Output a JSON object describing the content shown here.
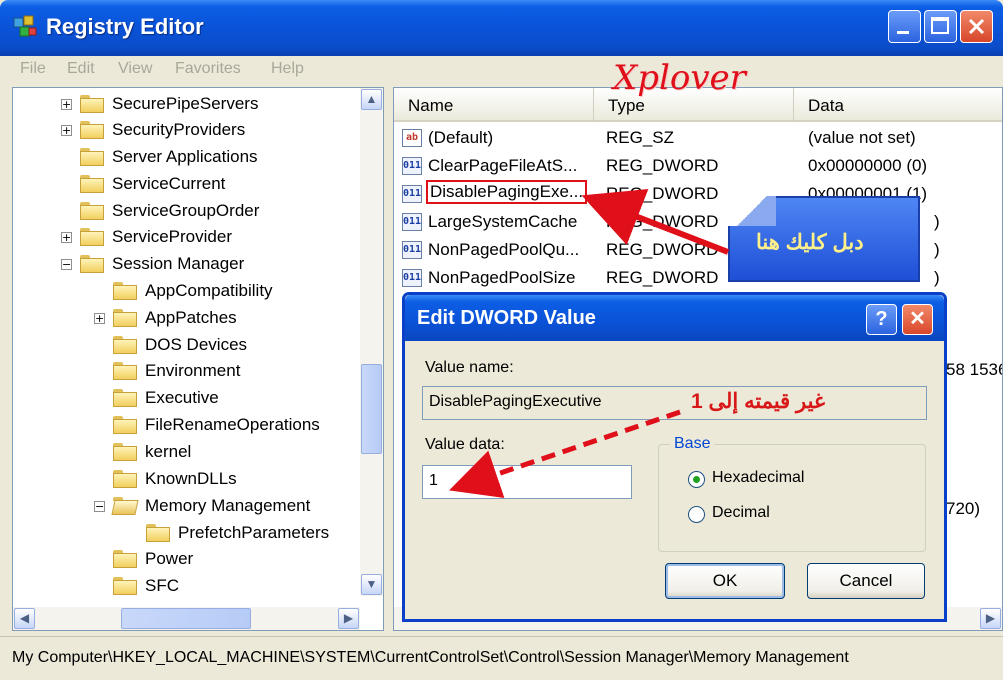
{
  "window": {
    "title": "Registry Editor"
  },
  "menu": [
    "File",
    "Edit",
    "View",
    "Favorites",
    "Help"
  ],
  "tree": {
    "items": [
      {
        "label": "SecurePipeServers",
        "expander": "+"
      },
      {
        "label": "SecurityProviders",
        "expander": "+"
      },
      {
        "label": "Server Applications",
        "expander": ""
      },
      {
        "label": "ServiceCurrent",
        "expander": ""
      },
      {
        "label": "ServiceGroupOrder",
        "expander": ""
      },
      {
        "label": "ServiceProvider",
        "expander": "+"
      },
      {
        "label": "Session Manager",
        "expander": "−"
      },
      {
        "label": "AppCompatibility",
        "expander": ""
      },
      {
        "label": "AppPatches",
        "expander": "+"
      },
      {
        "label": "DOS Devices",
        "expander": ""
      },
      {
        "label": "Environment",
        "expander": ""
      },
      {
        "label": "Executive",
        "expander": ""
      },
      {
        "label": "FileRenameOperations",
        "expander": ""
      },
      {
        "label": "kernel",
        "expander": ""
      },
      {
        "label": "KnownDLLs",
        "expander": ""
      },
      {
        "label": "Memory Management",
        "expander": "−"
      },
      {
        "label": "PrefetchParameters",
        "expander": ""
      },
      {
        "label": "Power",
        "expander": ""
      },
      {
        "label": "SFC",
        "expander": ""
      }
    ]
  },
  "list": {
    "headers": [
      "Name",
      "Type",
      "Data"
    ],
    "rows": [
      {
        "icon": "ab",
        "name": "(Default)",
        "type": "REG_SZ",
        "data": "(value not set)"
      },
      {
        "icon": "dw",
        "name": "ClearPageFileAtS...",
        "type": "REG_DWORD",
        "data": "0x00000000 (0)"
      },
      {
        "icon": "dw",
        "name": "DisablePagingExe...",
        "type": "REG_DWORD",
        "data": "0x00000001 (1)"
      },
      {
        "icon": "dw",
        "name": "LargeSystemCache",
        "type": "REG_DWORD",
        "data": ")"
      },
      {
        "icon": "dw",
        "name": "NonPagedPoolQu...",
        "type": "REG_DWORD",
        "data": ")"
      },
      {
        "icon": "dw",
        "name": "NonPagedPoolSize",
        "type": "REG_DWORD",
        "data": ")"
      }
    ],
    "partial_data": [
      "58 1536",
      "720)"
    ]
  },
  "statusbar": {
    "path": "My Computer\\HKEY_LOCAL_MACHINE\\SYSTEM\\CurrentControlSet\\Control\\Session Manager\\Memory Management"
  },
  "dialog": {
    "title": "Edit DWORD Value",
    "help_glyph": "?",
    "close_glyph": "✕",
    "value_name_label": "Value name:",
    "value_name": "DisablePagingExecutive",
    "value_data_label": "Value data:",
    "value_data": "1",
    "base_label": "Base",
    "base_options": [
      "Hexadecimal",
      "Decimal"
    ],
    "base_selected": "Hexadecimal",
    "ok_label": "OK",
    "cancel_label": "Cancel"
  },
  "annotations": {
    "watermark": "Xplover",
    "callout": "دبل كليك هنا",
    "note": "غير قيمته إلى 1",
    "accent_color": "#e0101a"
  }
}
